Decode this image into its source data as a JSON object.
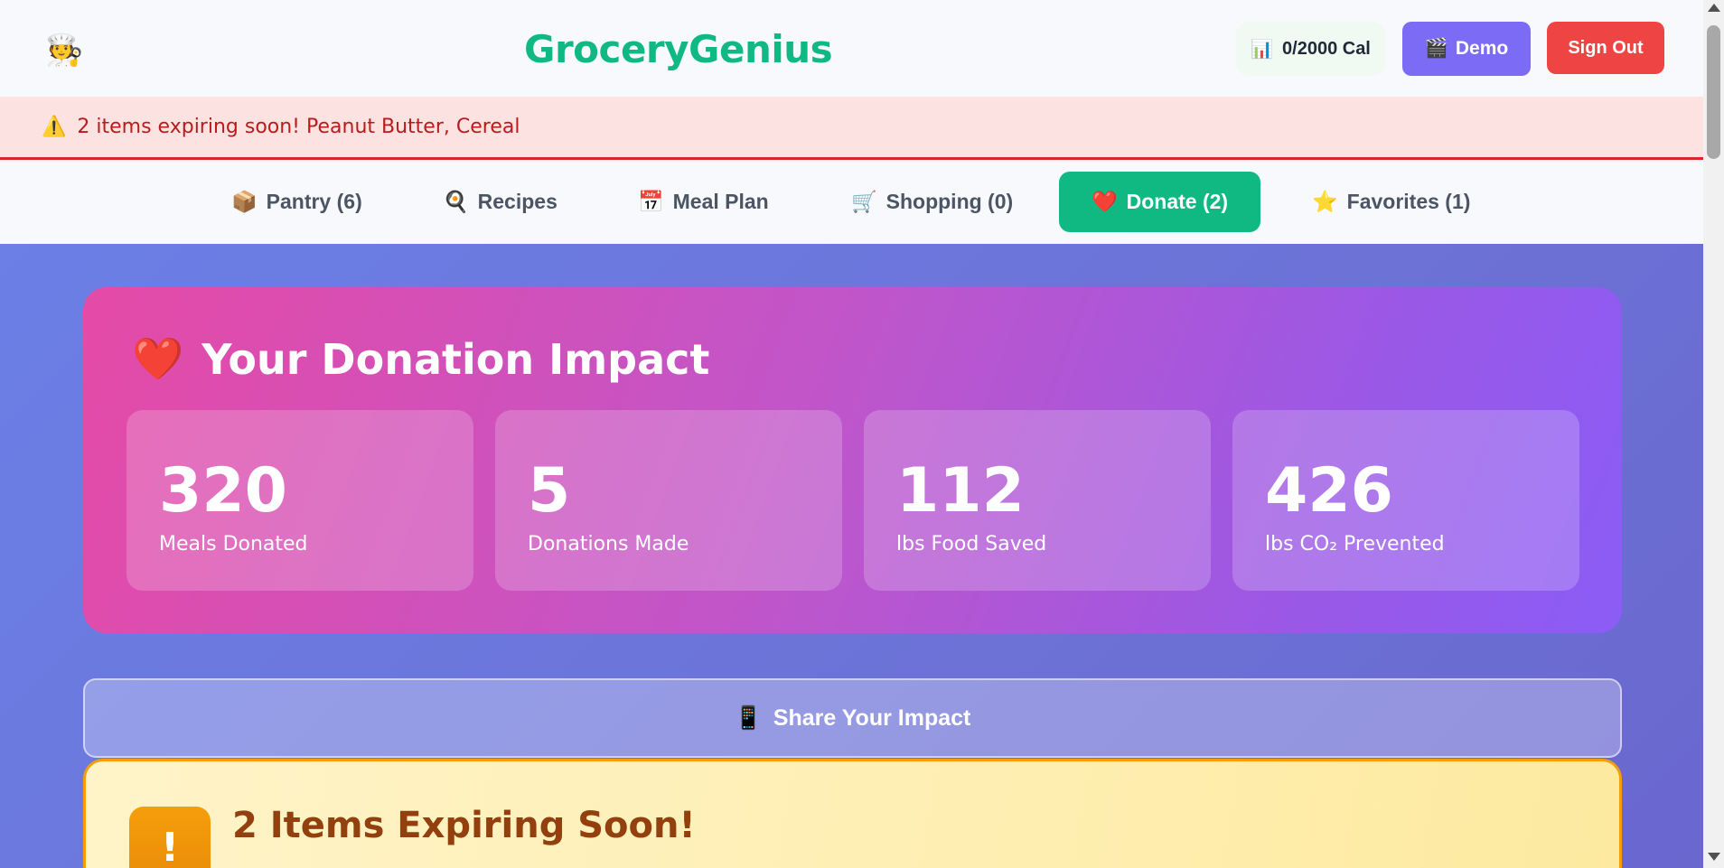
{
  "header": {
    "logo_icon": "🧑‍🍳",
    "brand": "GroceryGenius",
    "calories_icon": "📊",
    "calories": "0/2000 Cal",
    "demo_icon": "🎬",
    "demo_label": "Demo",
    "signout_label": "Sign Out"
  },
  "alert": {
    "icon": "⚠️",
    "text": "2 items expiring soon! Peanut Butter, Cereal"
  },
  "tabs": [
    {
      "icon": "📦",
      "label": "Pantry (6)"
    },
    {
      "icon": "🍳",
      "label": "Recipes"
    },
    {
      "icon": "📅",
      "label": "Meal Plan"
    },
    {
      "icon": "🛒",
      "label": "Shopping (0)"
    },
    {
      "icon": "❤️",
      "label": "Donate (2)",
      "active": true
    },
    {
      "icon": "⭐",
      "label": "Favorites (1)"
    }
  ],
  "impact": {
    "icon": "❤️",
    "title": "Your Donation Impact",
    "stats": [
      {
        "value": "320",
        "label": "Meals Donated"
      },
      {
        "value": "5",
        "label": "Donations Made"
      },
      {
        "value": "112",
        "label": "lbs Food Saved"
      },
      {
        "value": "426",
        "label": "lbs CO₂ Prevented"
      }
    ]
  },
  "share": {
    "icon": "📱",
    "label": "Share Your Impact"
  },
  "expiring": {
    "icon": "!",
    "title": "2 Items Expiring Soon!"
  },
  "colors": {
    "brand": "#10b981",
    "demo": "#7c6cf5",
    "signout": "#ef4444",
    "alert_text": "#b91c1c"
  }
}
